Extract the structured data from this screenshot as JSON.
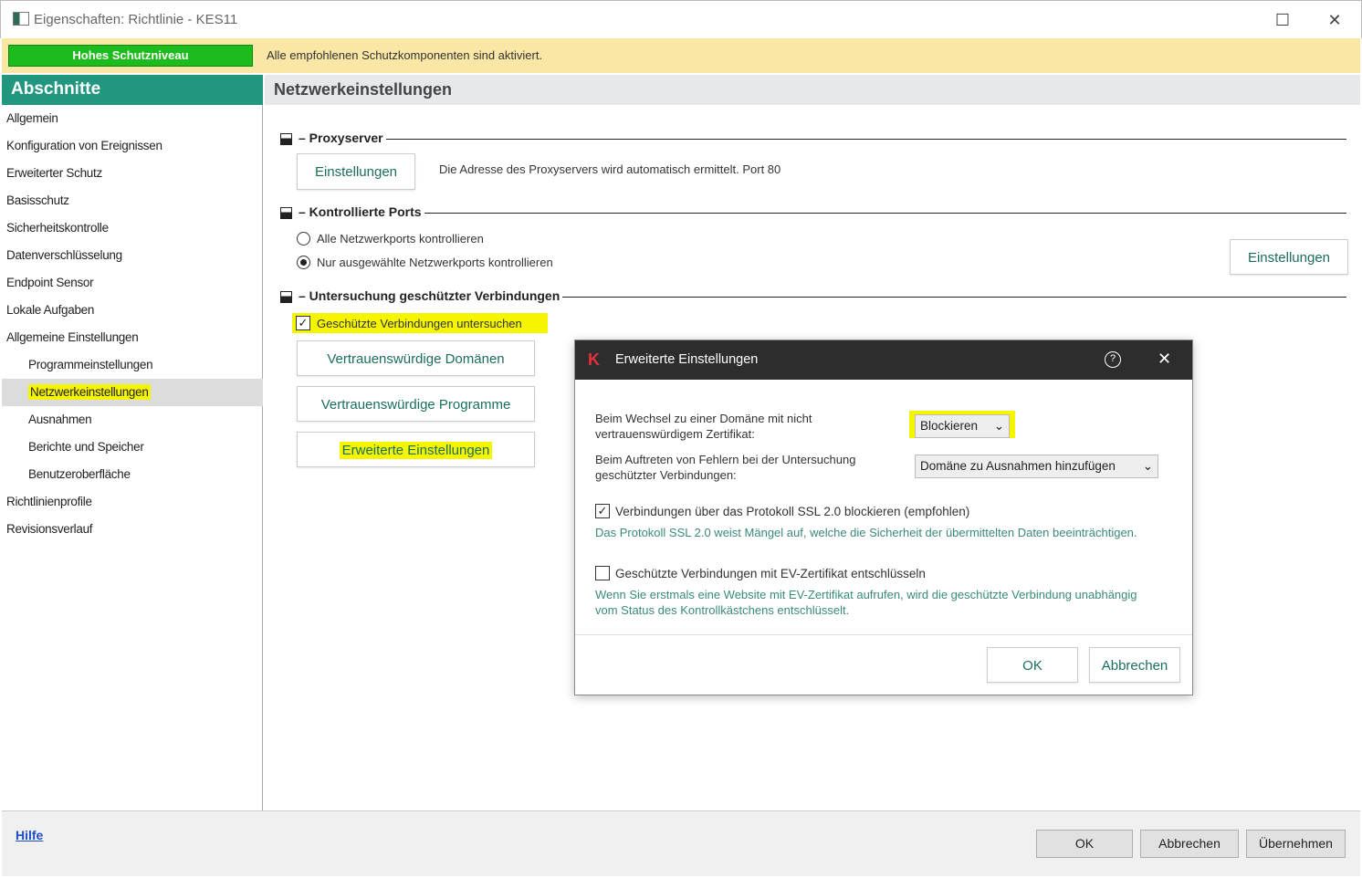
{
  "window": {
    "title": "Eigenschaften: Richtlinie - KES11",
    "maximize": "☐",
    "close": "✕"
  },
  "banner": {
    "level": "Hohes Schutzniveau",
    "message": "Alle empfohlenen Schutzkomponenten sind aktiviert."
  },
  "sidebar": {
    "title": "Abschnitte",
    "items": [
      {
        "label": "Allgemein"
      },
      {
        "label": "Konfiguration von Ereignissen"
      },
      {
        "label": "Erweiterter Schutz"
      },
      {
        "label": "Basisschutz"
      },
      {
        "label": "Sicherheitskontrolle"
      },
      {
        "label": "Datenverschlüsselung"
      },
      {
        "label": "Endpoint Sensor"
      },
      {
        "label": "Lokale Aufgaben"
      },
      {
        "label": "Allgemeine Einstellungen"
      },
      {
        "label": "Programmeinstellungen"
      },
      {
        "label": "Netzwerkeinstellungen"
      },
      {
        "label": "Ausnahmen"
      },
      {
        "label": "Berichte und Speicher"
      },
      {
        "label": "Benutzeroberfläche"
      },
      {
        "label": "Richtlinienprofile"
      },
      {
        "label": "Revisionsverlauf"
      }
    ]
  },
  "main": {
    "title": "Netzwerkeinstellungen",
    "proxy": {
      "title": "– Proxyserver",
      "button": "Einstellungen",
      "info": "Die Adresse des Proxyservers wird automatisch ermittelt. Port 80"
    },
    "ports": {
      "title": "– Kontrollierte Ports",
      "option_all": "Alle Netzwerkports kontrollieren",
      "option_selected": "Nur ausgewählte Netzwerkports kontrollieren",
      "button": "Einstellungen"
    },
    "scan": {
      "title": "– Untersuchung geschützter Verbindungen",
      "checkbox": "Geschützte Verbindungen untersuchen",
      "btn_domains": "Vertrauenswürdige Domänen",
      "btn_programs": "Vertrauenswürdige Programme",
      "btn_advanced": "Erweiterte Einstellungen"
    }
  },
  "dialog": {
    "title": "Erweiterte Einstellungen",
    "help": "?",
    "close": "✕",
    "untrusted_label": "Beim Wechsel zu einer Domäne mit nicht vertrauenswürdigem Zertifikat:",
    "untrusted_value": "Blockieren",
    "error_label": "Beim Auftreten von Fehlern bei der Untersuchung geschützter Verbindungen:",
    "error_value": "Domäne zu Ausnahmen hinzufügen",
    "ssl_checkbox": "Verbindungen über das Protokoll SSL 2.0 blockieren (empfohlen)",
    "ssl_note": "Das Protokoll SSL 2.0 weist Mängel auf, welche die Sicherheit der übermittelten Daten beeinträchtigen.",
    "ev_checkbox": "Geschützte Verbindungen mit EV-Zertifikat entschlüsseln",
    "ev_note": "Wenn Sie erstmals eine Website mit EV-Zertifikat aufrufen, wird die geschützte  Verbindung unabhängig vom Status des Kontrollkästchens entschlüsselt.",
    "ok": "OK",
    "cancel": "Abbrechen"
  },
  "footer": {
    "help": "Hilfe",
    "ok": "OK",
    "cancel": "Abbrechen",
    "apply": "Übernehmen"
  }
}
